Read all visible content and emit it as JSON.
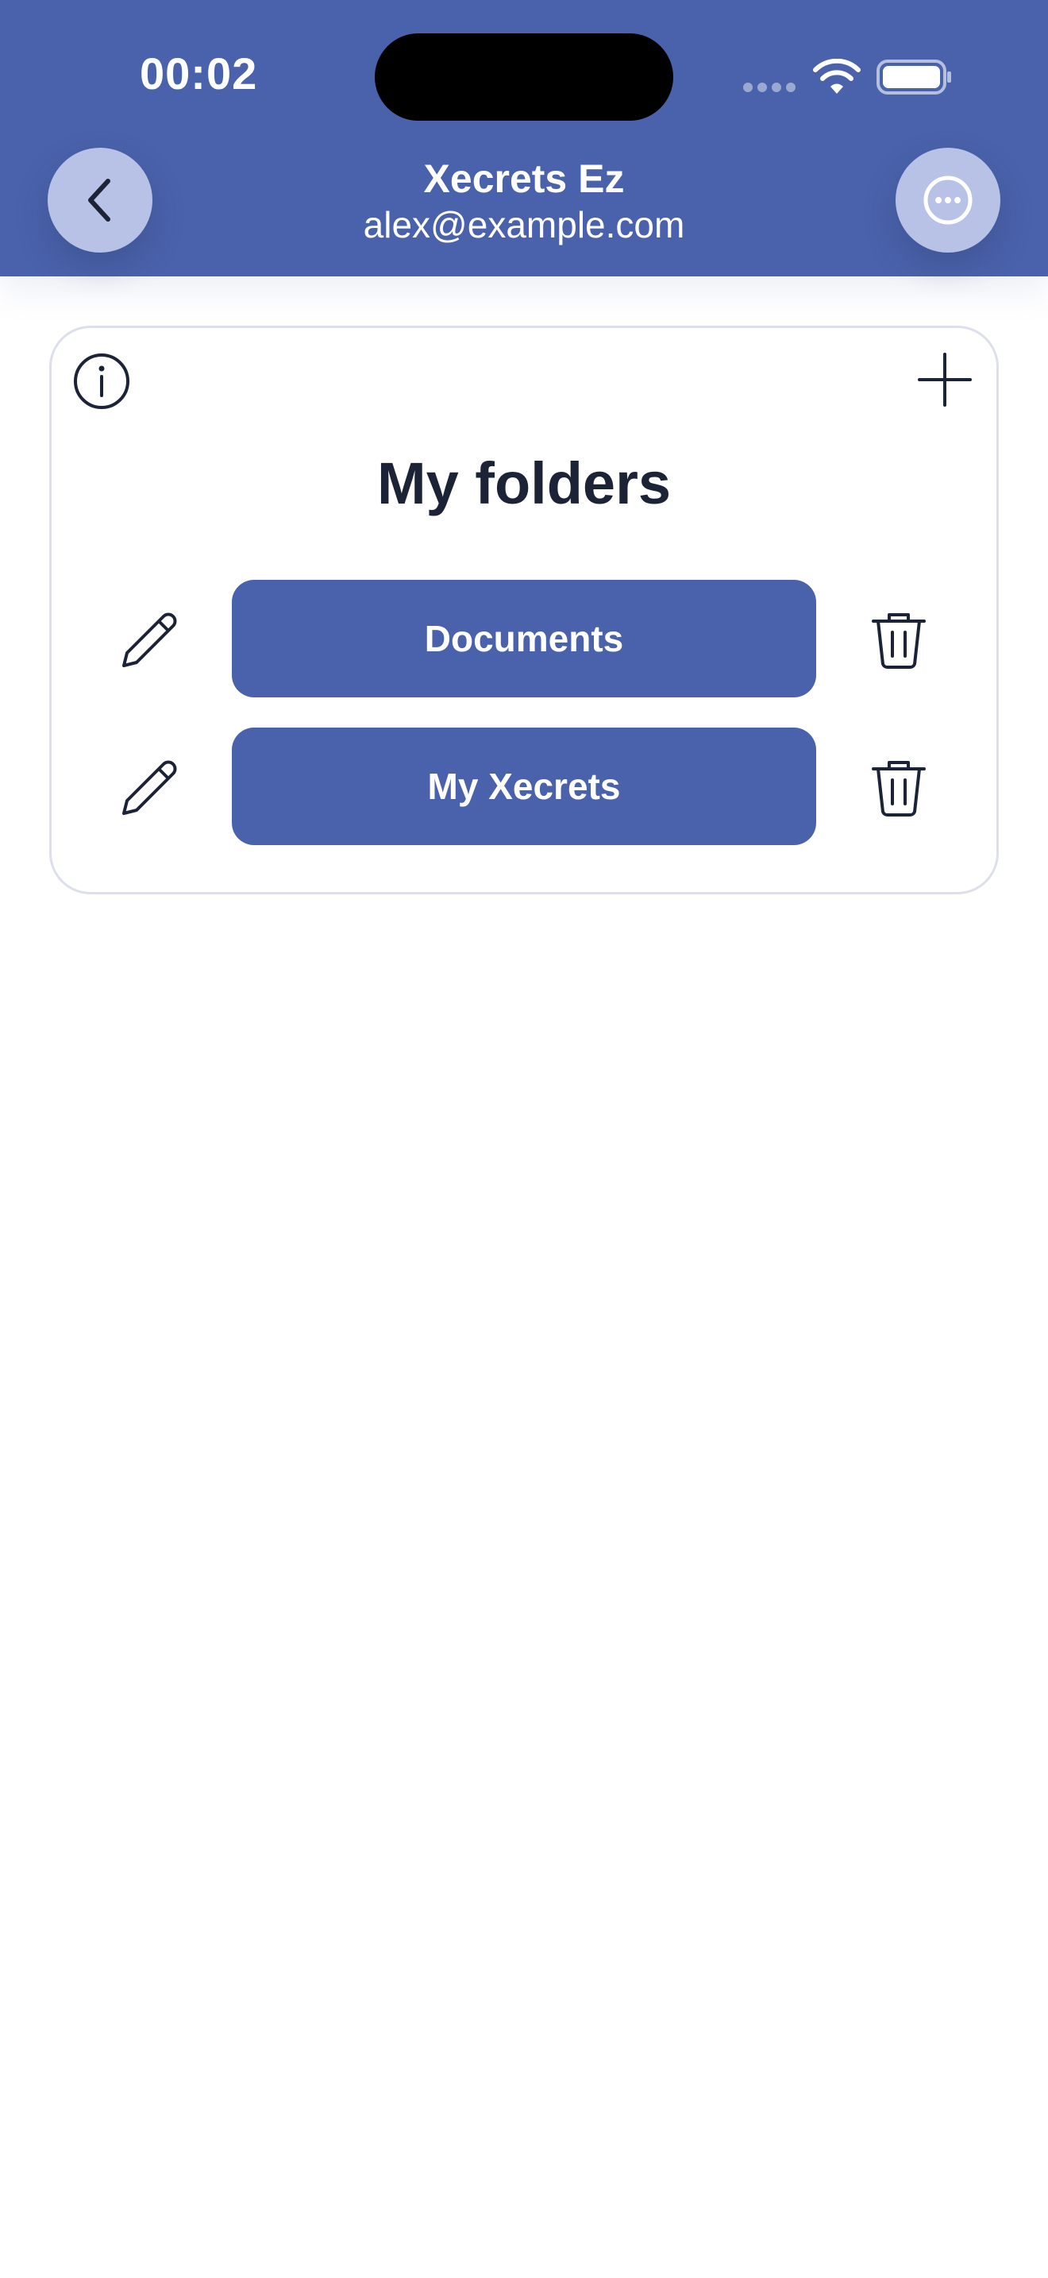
{
  "status_bar": {
    "time": "00:02"
  },
  "header": {
    "title": "Xecrets Ez",
    "subtitle": "alex@example.com",
    "back_icon": "chevron-left-icon",
    "more_icon": "ellipsis-circle-icon",
    "background_color": "#4a62ab"
  },
  "folders_card": {
    "title": "My folders",
    "info_icon": "info-circle-icon",
    "add_icon": "plus-icon",
    "folders": [
      {
        "label": "Documents",
        "edit_icon": "pencil-icon",
        "delete_icon": "trash-icon"
      },
      {
        "label": "My Xecrets",
        "edit_icon": "pencil-icon",
        "delete_icon": "trash-icon"
      }
    ]
  },
  "colors": {
    "accent": "#4a62ab",
    "round_button": "#b8c2e6",
    "text_dark": "#1c2336",
    "card_border": "#dde0ec"
  }
}
